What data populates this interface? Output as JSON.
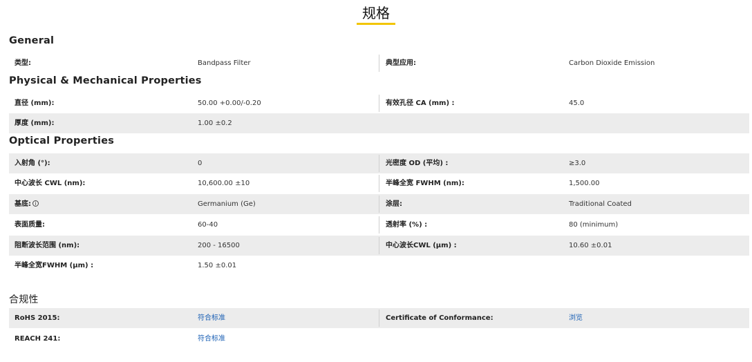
{
  "page_title": "规格",
  "sections": {
    "general": {
      "title": "General",
      "rows": [
        {
          "label1": "类型:",
          "value1": "Bandpass Filter",
          "label2": "典型应用:",
          "value2": "Carbon Dioxide Emission"
        }
      ]
    },
    "physical": {
      "title": "Physical & Mechanical Properties",
      "rows": [
        {
          "label1": "直径 (mm):",
          "value1": "50.00 +0.00/-0.20",
          "label2": "有效孔径 CA (mm) :",
          "value2": "45.0"
        },
        {
          "label1": "厚度 (mm):",
          "value1": "1.00 ±0.2"
        }
      ]
    },
    "optical": {
      "title": "Optical Properties",
      "rows": [
        {
          "label1": "入射角 (°):",
          "value1": "0",
          "label2": "光密度 OD (平均) :",
          "value2": "≥3.0"
        },
        {
          "label1": "中心波长 CWL (nm):",
          "value1": "10,600.00 ±10",
          "label2": "半峰全宽 FWHM (nm):",
          "value2": "1,500.00"
        },
        {
          "label1": "基底:",
          "value1": "Germanium (Ge)",
          "label2": "涂层:",
          "value2": "Traditional Coated"
        },
        {
          "label1": "表面质量:",
          "value1": "60-40",
          "label2": "透射率 (%) :",
          "value2": "80 (minimum)"
        },
        {
          "label1": "阻断波长范围 (nm):",
          "value1": "200 - 16500",
          "label2": "中心波长CWL (μm) :",
          "value2": "10.60 ±0.01"
        },
        {
          "label1": "半峰全宽FWHM (μm) :",
          "value1": "1.50 ±0.01"
        }
      ]
    },
    "compliance": {
      "title": "合规性",
      "rows": [
        {
          "label1": "RoHS 2015:",
          "value1": "符合标准",
          "label2": "Certificate of Conformance:",
          "value2": "浏览"
        },
        {
          "label1": "REACH 241:",
          "value1": "符合标准"
        }
      ]
    }
  },
  "info_icon_glyph": "i",
  "colors": {
    "accent_underline": "#f2c500",
    "link": "#1a5fb4",
    "row_shade": "#ececec"
  }
}
